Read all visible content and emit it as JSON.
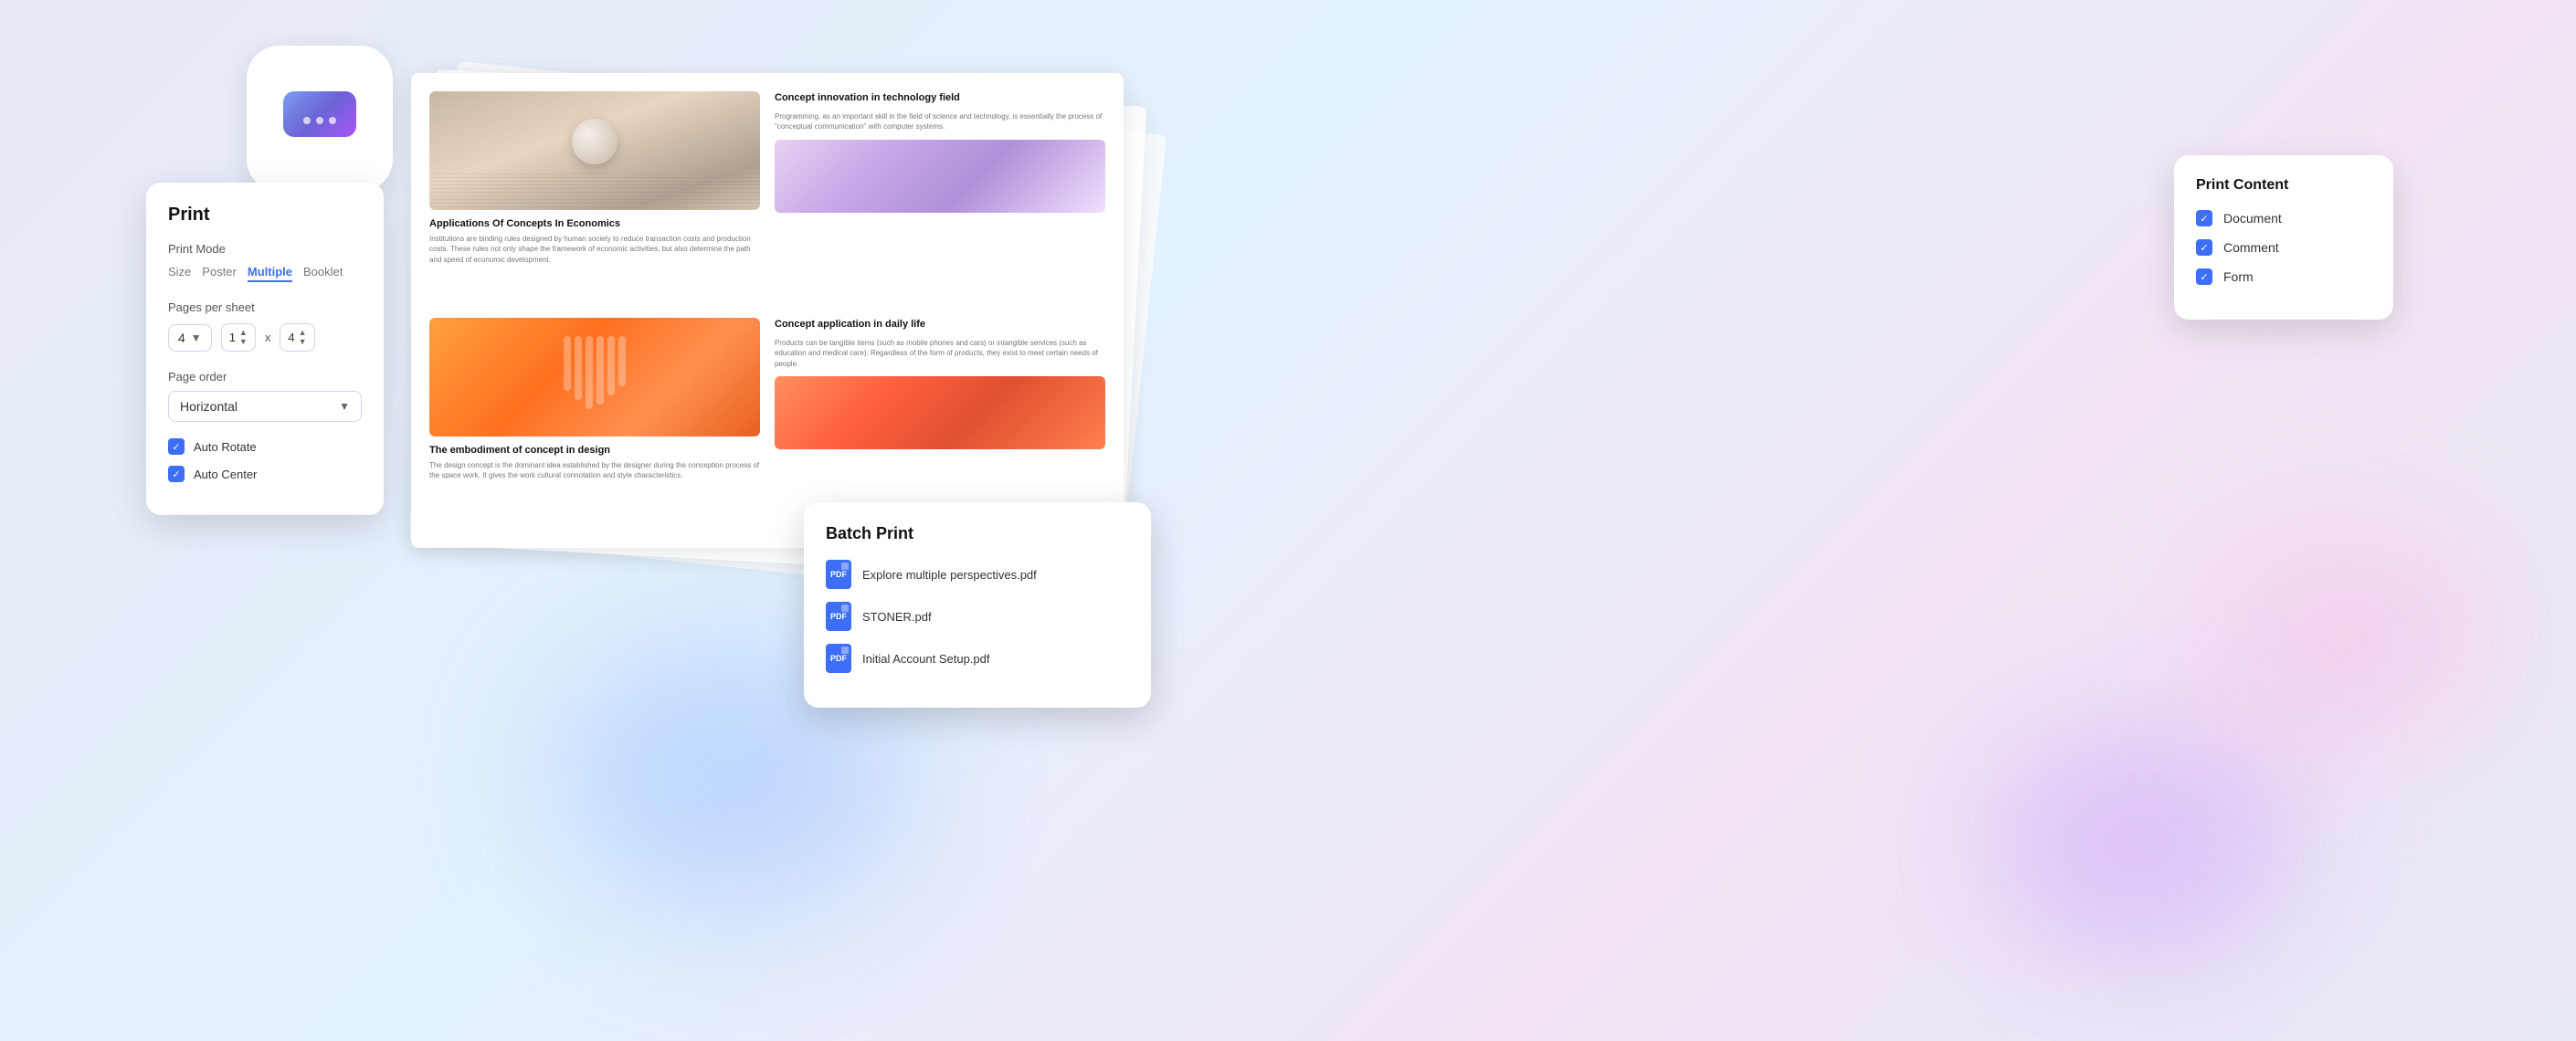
{
  "app": {
    "title": "Batch Print"
  },
  "print_panel": {
    "title": "Print",
    "print_mode_label": "Print Mode",
    "tabs": [
      {
        "id": "size",
        "label": "Size",
        "active": false
      },
      {
        "id": "poster",
        "label": "Poster",
        "active": false
      },
      {
        "id": "multiple",
        "label": "Multiple",
        "active": true
      },
      {
        "id": "booklet",
        "label": "Booklet",
        "active": false
      }
    ],
    "pages_per_sheet_label": "Pages per sheet",
    "pages_per_sheet_value": "4",
    "pages_x": "1",
    "pages_y": "4",
    "x_separator": "x",
    "page_order_label": "Page order",
    "page_order_value": "Horizontal",
    "auto_rotate_label": "Auto Rotate",
    "auto_center_label": "Auto Center"
  },
  "print_content_panel": {
    "title": "Print Content",
    "items": [
      {
        "label": "Document",
        "checked": true
      },
      {
        "label": "Comment",
        "checked": true
      },
      {
        "label": "Form",
        "checked": true
      }
    ]
  },
  "batch_print_panel": {
    "title": "Batch Print",
    "files": [
      {
        "name": "Explore multiple perspectives.pdf"
      },
      {
        "name": "STONER.pdf"
      },
      {
        "name": "Initial Account Setup.pdf"
      }
    ]
  },
  "doc_preview": {
    "cells": [
      {
        "id": "cell-1",
        "title": "Applications Of Concepts In Economics",
        "body": "Institutions are binding rules designed by human society to reduce transaction costs and production costs. These rules not only shape the framework of economic activities, but also determine the path and speed of economic development."
      },
      {
        "id": "cell-2",
        "title": "Concept innovation in technology field",
        "body": "Programming, as an important skill in the field of science and technology, is essentially the process of \"conceptual communication\" with computer systems."
      },
      {
        "id": "cell-3",
        "title": "The embodiment of concept in design",
        "body": "The design concept is the dominant idea established by the designer during the conception process of the space work. It gives the work cultural connotation and style characteristics."
      },
      {
        "id": "cell-4",
        "title": "Concept application in daily life",
        "body": "Products can be tangible items (such as mobile phones and cars) or intangible services (such as education and medical care). Regardless of the form of products, they exist to meet certain needs of people."
      }
    ]
  },
  "icons": {
    "checkbox_check": "✓",
    "dropdown_arrow": "▼",
    "stepper_up": "▲",
    "stepper_down": "▼"
  }
}
